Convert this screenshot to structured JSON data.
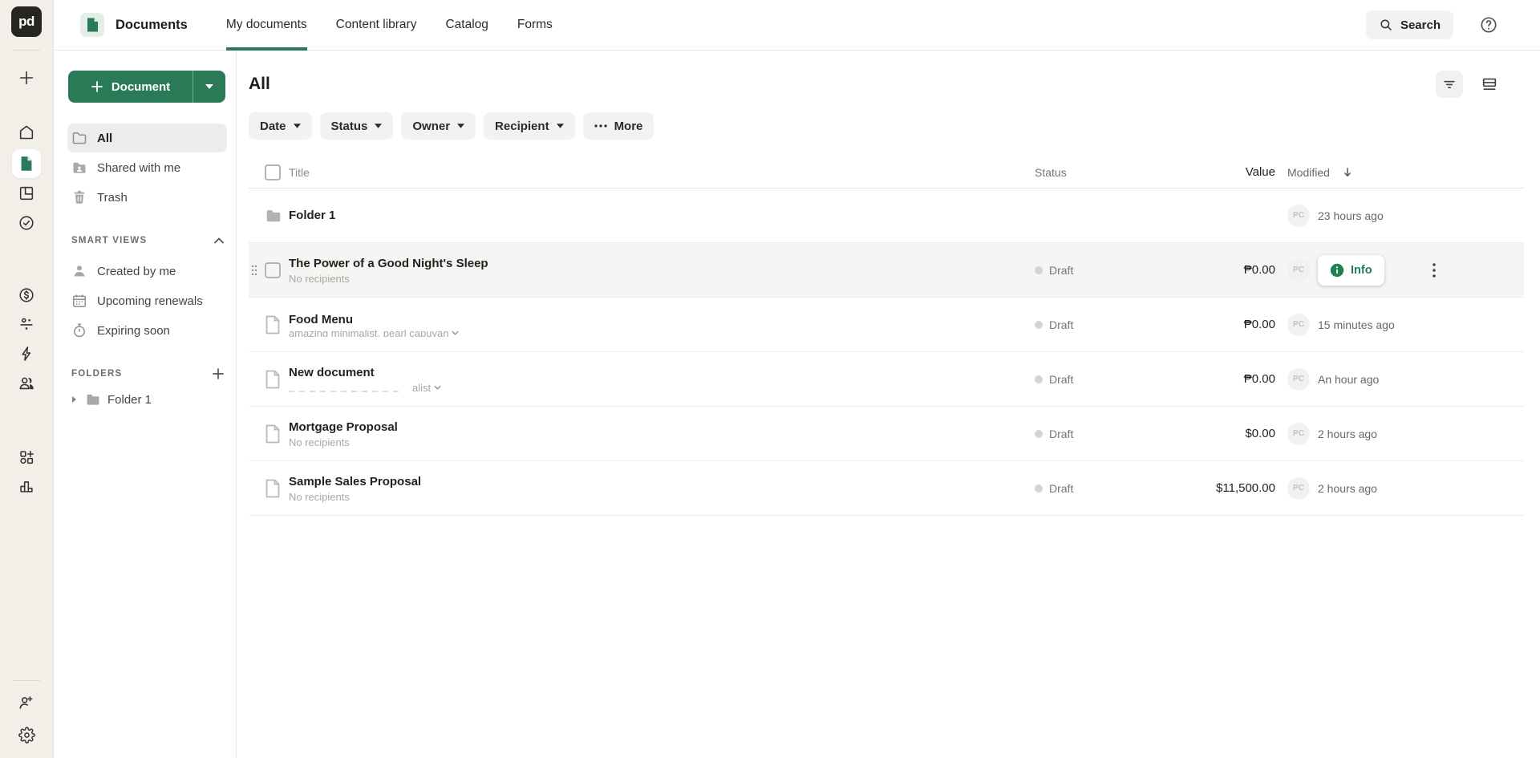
{
  "topbar": {
    "logo_text": "pd",
    "section": "Documents",
    "tabs": [
      {
        "label": "My documents",
        "active": true
      },
      {
        "label": "Content library",
        "active": false
      },
      {
        "label": "Catalog",
        "active": false
      },
      {
        "label": "Forms",
        "active": false
      }
    ],
    "search_label": "Search"
  },
  "rail": {
    "icons": [
      "plus",
      "home",
      "documents",
      "templates",
      "approvals",
      "payments",
      "contacts",
      "automations",
      "workspace-members",
      "add-ons",
      "reports",
      "invite-user",
      "settings"
    ],
    "active_icon": "documents"
  },
  "sidebar": {
    "new_document_label": "Document",
    "items": [
      {
        "label": "All",
        "active": true
      },
      {
        "label": "Shared with me",
        "active": false
      },
      {
        "label": "Trash",
        "active": false
      }
    ],
    "smart_views_header": "SMART VIEWS",
    "smart_views": [
      {
        "label": "Created by me"
      },
      {
        "label": "Upcoming renewals"
      },
      {
        "label": "Expiring soon"
      }
    ],
    "folders_header": "FOLDERS",
    "folders": [
      {
        "label": "Folder 1"
      }
    ]
  },
  "content": {
    "heading": "All",
    "filters": [
      {
        "label": "Date"
      },
      {
        "label": "Status"
      },
      {
        "label": "Owner"
      },
      {
        "label": "Recipient"
      },
      {
        "label": "More"
      }
    ],
    "table": {
      "columns": {
        "title": "Title",
        "status": "Status",
        "value": "Value",
        "modified": "Modified"
      },
      "rows": [
        {
          "type": "folder",
          "title": "Folder 1",
          "modified": "23 hours ago",
          "avatar": "PC"
        },
        {
          "type": "document",
          "title": "The Power of a Good Night's Sleep",
          "subtitle": "No recipients",
          "status": "Draft",
          "value": "₱0.00",
          "avatar": "PC",
          "info_label": "Info",
          "hovered": true
        },
        {
          "type": "document",
          "title": "Food Menu",
          "subtitle": "amazing minimalist, pearl capuyan",
          "status": "Draft",
          "value": "₱0.00",
          "avatar": "PC",
          "modified": "15 minutes ago"
        },
        {
          "type": "document",
          "title": "New document",
          "subtitle_visible": "alist",
          "status": "Draft",
          "value": "₱0.00",
          "avatar": "PC",
          "modified": "An hour ago"
        },
        {
          "type": "document",
          "title": "Mortgage Proposal",
          "subtitle": "No recipients",
          "status": "Draft",
          "value": "$0.00",
          "avatar": "PC",
          "modified": "2 hours ago"
        },
        {
          "type": "document",
          "title": "Sample Sales Proposal",
          "subtitle": "No recipients",
          "status": "Draft",
          "value": "$11,500.00",
          "avatar": "PC",
          "modified": "2 hours ago"
        }
      ]
    }
  },
  "colors": {
    "brand_green": "#2b7a57",
    "rail_background": "#f2efe9",
    "hover_row_background": "#f5f5f3",
    "info_green": "#1d8150",
    "status_dot": "#d4d4d1"
  }
}
